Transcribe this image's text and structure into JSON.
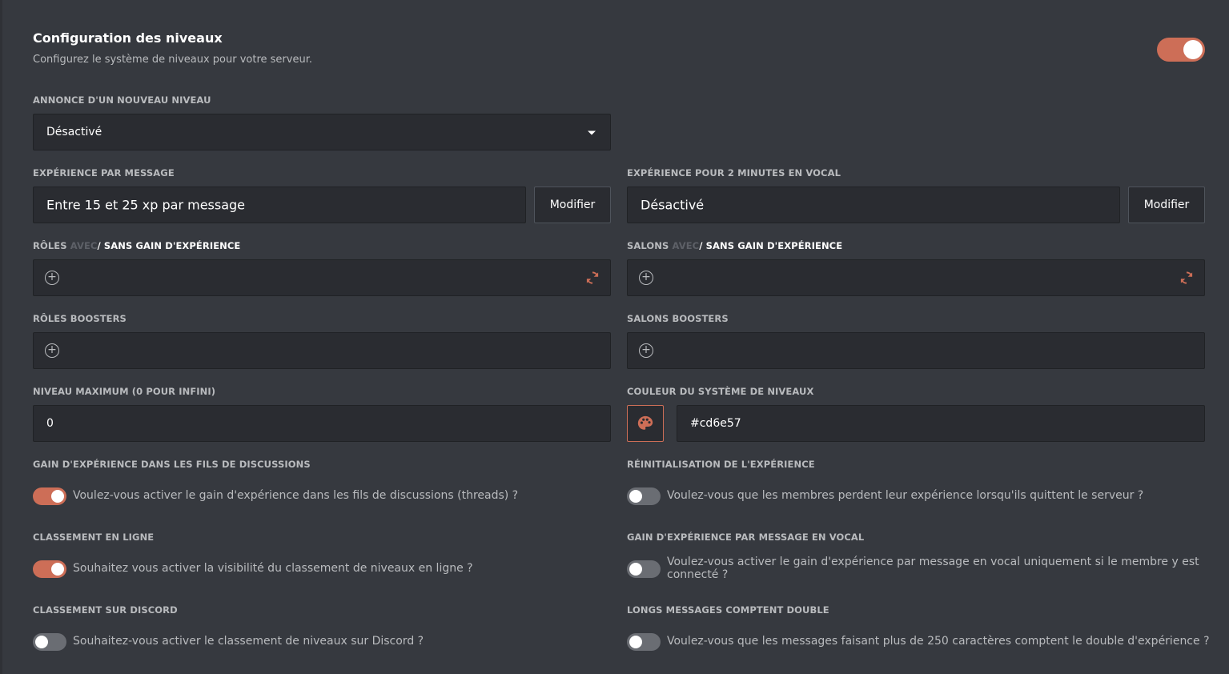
{
  "header": {
    "title": "Configuration des niveaux",
    "subtitle": "Configurez le système de niveaux pour votre serveur.",
    "enabled": true
  },
  "colors": {
    "accent": "#cd6e57",
    "background": "#36393f",
    "input_bg": "#2a2c31"
  },
  "announce": {
    "label": "ANNONCE D'UN NOUVEAU NIVEAU",
    "value": "Désactivé"
  },
  "xp_message": {
    "label": "EXPÉRIENCE PAR MESSAGE",
    "value": "Entre 15 et 25 xp par message",
    "button": "Modifier"
  },
  "xp_voice": {
    "label": "EXPÉRIENCE POUR 2 MINUTES EN VOCAL",
    "value": "Désactivé",
    "button": "Modifier"
  },
  "roles_xp": {
    "label_prefix": "RÔLES",
    "label_avec": "AVEC",
    "label_sep": "/",
    "label_suffix": "SANS GAIN D'EXPÉRIENCE"
  },
  "channels_xp": {
    "label_prefix": "SALONS",
    "label_avec": "AVEC",
    "label_sep": "/",
    "label_suffix": "SANS GAIN D'EXPÉRIENCE"
  },
  "roles_boosters": {
    "label": "RÔLES BOOSTERS"
  },
  "channels_boosters": {
    "label": "SALONS BOOSTERS"
  },
  "max_level": {
    "label": "NIVEAU MAXIMUM (0 POUR INFINI)",
    "value": "0"
  },
  "level_color": {
    "label": "COULEUR DU SYSTÈME DE NIVEAUX",
    "value": "#cd6e57"
  },
  "threads": {
    "label": "GAIN D'EXPÉRIENCE DANS LES FILS DE DISCUSSIONS",
    "text": "Voulez-vous activer le gain d'expérience dans les fils de discussions (threads) ?",
    "enabled": true
  },
  "reset_xp": {
    "label": "RÉINITIALISATION DE L'EXPÉRIENCE",
    "text": "Voulez-vous que les membres perdent leur expérience lorsqu'ils quittent le serveur ?",
    "enabled": false
  },
  "online_ranking": {
    "label": "CLASSEMENT EN LIGNE",
    "text": "Souhaitez vous activer la visibilité du classement de niveaux en ligne ?",
    "enabled": true
  },
  "voice_message_xp": {
    "label": "GAIN D'EXPÉRIENCE PAR MESSAGE EN VOCAL",
    "text_line1": "Voulez-vous activer le gain d'expérience par message en vocal uniquement si le membre y est",
    "text_line2": "connecté ?",
    "enabled": false
  },
  "discord_ranking": {
    "label": "CLASSEMENT SUR DISCORD",
    "text": "Souhaitez-vous activer le classement de niveaux sur Discord ?",
    "enabled": false
  },
  "long_messages": {
    "label": "LONGS MESSAGES COMPTENT DOUBLE",
    "text": "Voulez-vous que les messages faisant plus de 250 caractères comptent le double d'expérience ?",
    "enabled": false
  },
  "icons": {
    "dropdown": "chevron-down-icon",
    "add": "plus-circle-icon",
    "refresh": "refresh-icon",
    "palette": "palette-icon"
  }
}
